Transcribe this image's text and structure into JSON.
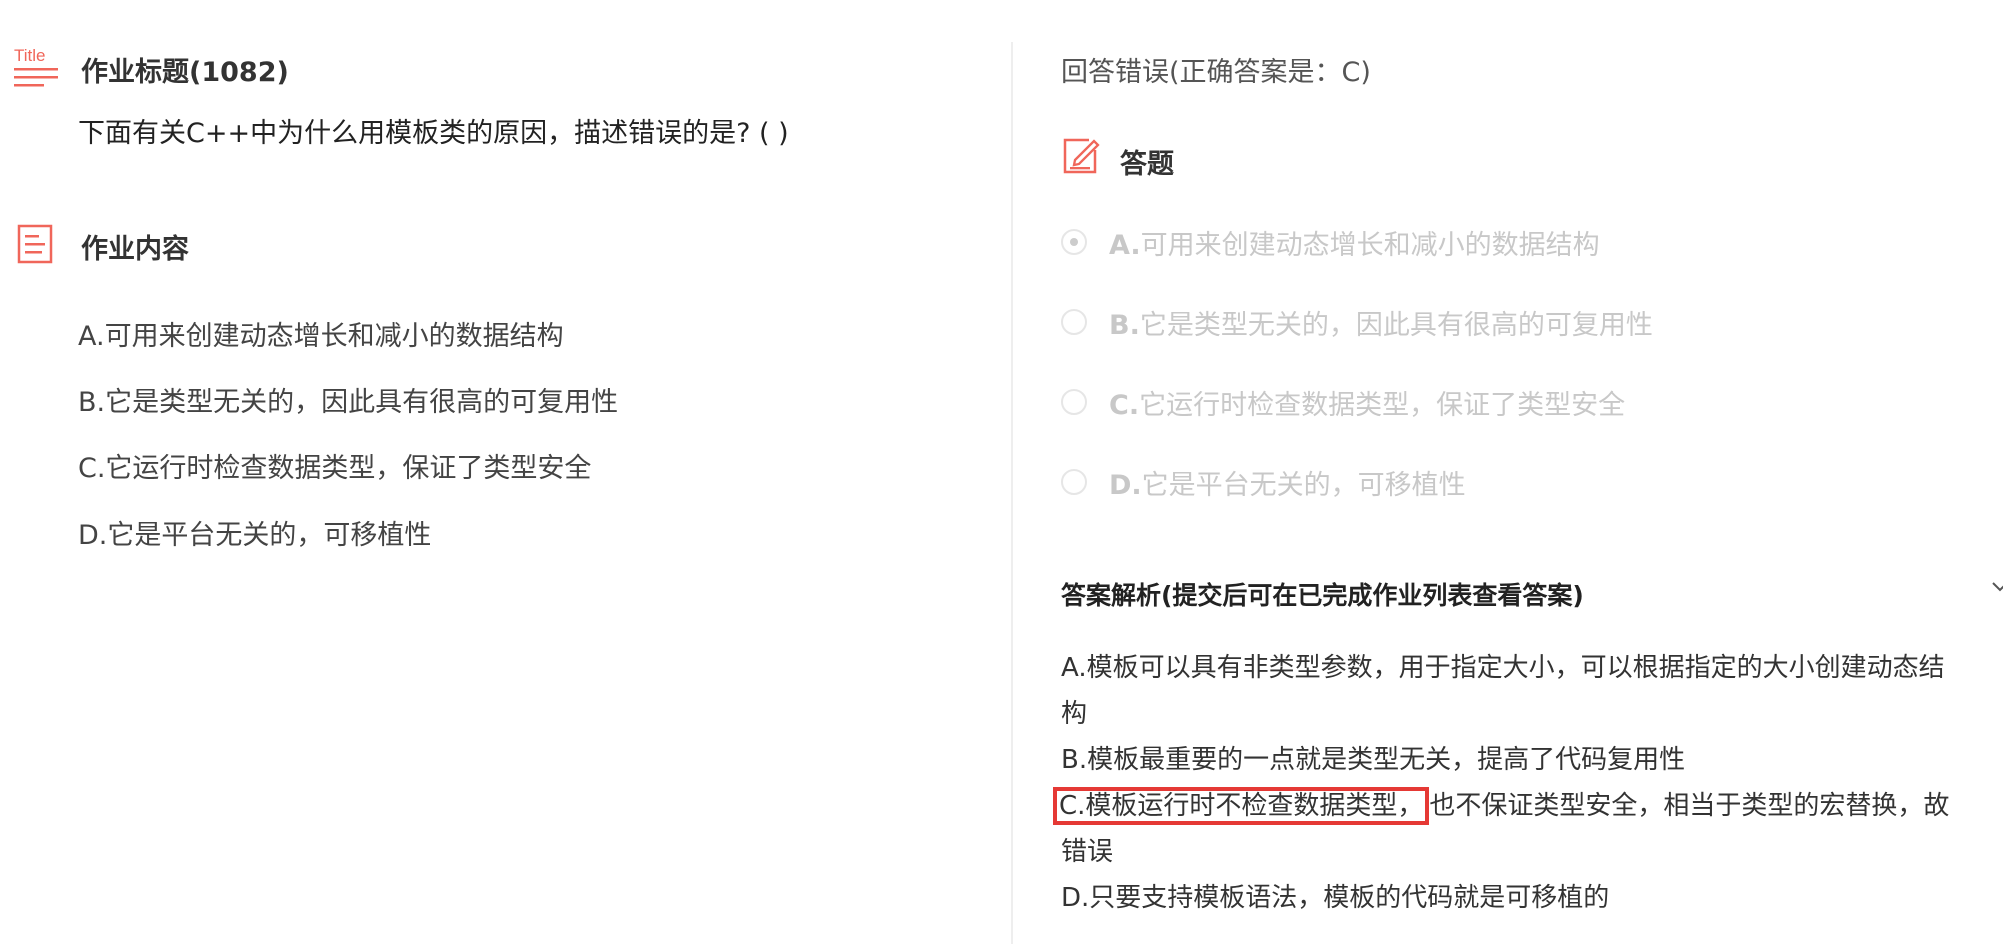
{
  "left": {
    "title_section": {
      "icon": "title-icon",
      "icon_text": "Title",
      "heading": "作业标题(1082)",
      "question": "下面有关C++中为什么用模板类的原因，描述错误的是? ( )"
    },
    "content_section": {
      "icon": "document-icon",
      "heading": "作业内容",
      "options": [
        "A.可用来创建动态增长和减小的数据结构",
        "B.它是类型无关的，因此具有很高的可复用性",
        "C.它运行时检查数据类型，保证了类型安全",
        "D.它是平台无关的，可移植性"
      ]
    }
  },
  "right": {
    "result": "回答错误(正确答案是：C)",
    "answer_section": {
      "icon": "edit-icon",
      "heading": "答题",
      "choices": [
        {
          "letter": "A.",
          "text": "可用来创建动态增长和减小的数据结构",
          "selected": true
        },
        {
          "letter": "B.",
          "text": "它是类型无关的，因此具有很高的可复用性",
          "selected": false
        },
        {
          "letter": "C.",
          "text": "它运行时检查数据类型，保证了类型安全",
          "selected": false
        },
        {
          "letter": "D.",
          "text": "它是平台无关的，可移植性",
          "selected": false
        }
      ]
    },
    "analysis": {
      "heading": "答案解析(提交后可在已完成作业列表查看答案)",
      "lines": {
        "a1": "A.模板可以具有非类型参数，用于指定大小，可以根据指定的大小创建动态结",
        "a2": "构",
        "b1": "B.模板最重要的一点就是类型无关，提高了代码复用性",
        "c_highlight": "C.模板运行时不检查数据类型，",
        "c_rest": "也不保证类型安全，相当于类型的宏替换，故",
        "c2": "错误",
        "d1": "D.只要支持模板语法，模板的代码就是可移植的"
      }
    }
  },
  "colors": {
    "accent": "#f0665a",
    "disabled_text": "#c8c8c8",
    "highlight_border": "#e53935"
  }
}
